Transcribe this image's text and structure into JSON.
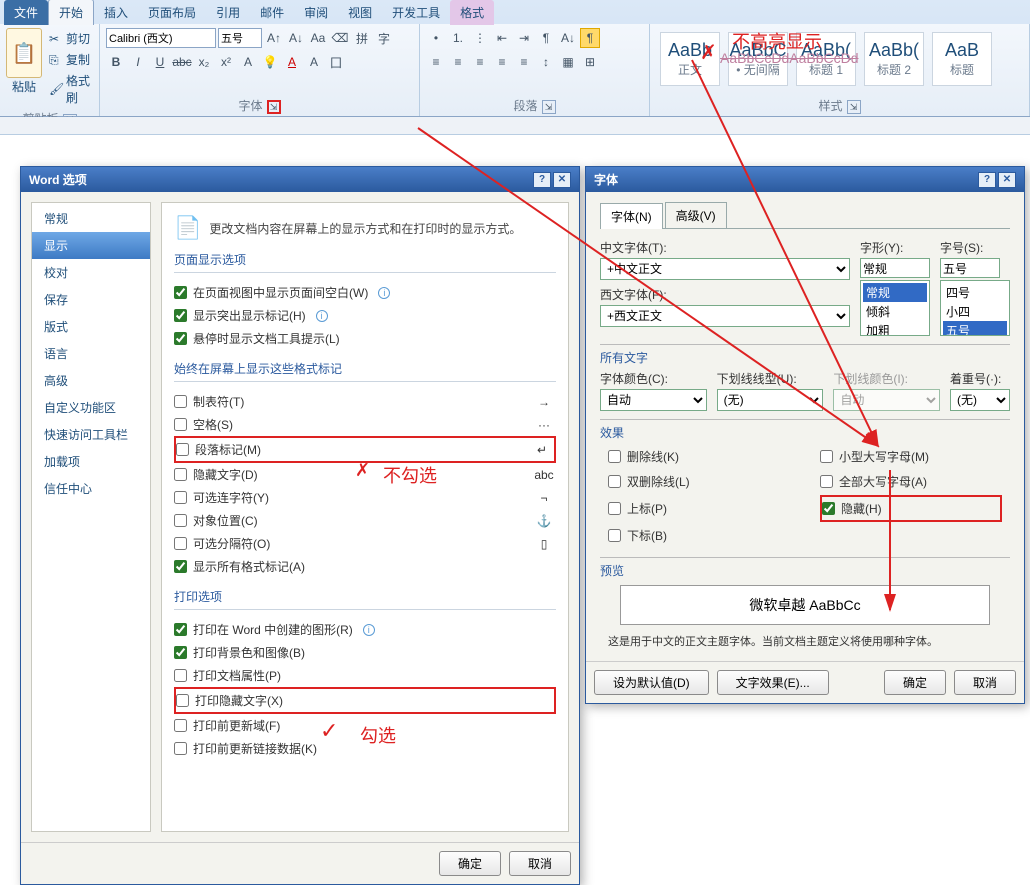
{
  "tabs": {
    "file": "文件",
    "home": "开始",
    "insert": "插入",
    "layout": "页面布局",
    "ref": "引用",
    "mail": "邮件",
    "review": "审阅",
    "view": "视图",
    "dev": "开发工具",
    "fmt": "格式"
  },
  "clip": {
    "cut": "剪切",
    "copy": "复制",
    "brush": "格式刷",
    "paste": "粘贴",
    "title": "剪贴板"
  },
  "font": {
    "name": "Calibri (西文)",
    "size": "五号",
    "title": "字体"
  },
  "para": {
    "title": "段落"
  },
  "styles": {
    "title": "样式",
    "items": [
      {
        "prev": "AaBb",
        "name": "正文"
      },
      {
        "prev": "AaBbC",
        "name": "• 无间隔"
      },
      {
        "prev": "AaBb(",
        "name": "标题 1"
      },
      {
        "prev": "AaBb(",
        "name": "标题 2"
      },
      {
        "prev": "AaB",
        "name": "标题"
      }
    ],
    "strike": "AaBbCcDdAaBbCcDd"
  },
  "anno": {
    "nohl": "不高亮显示",
    "nochk": "不勾选",
    "chk": "勾选"
  },
  "wordopt": {
    "title": "Word 选项",
    "nav": [
      "常规",
      "显示",
      "校对",
      "保存",
      "版式",
      "语言",
      "高级",
      "自定义功能区",
      "快速访问工具栏",
      "加载项",
      "信任中心"
    ],
    "navsel": 1,
    "intro": "更改文档内容在屏幕上的显示方式和在打印时的显示方式。",
    "sec1": "页面显示选项",
    "c1": [
      {
        "t": "在页面视图中显示页面间空白(W)",
        "v": true,
        "i": true
      },
      {
        "t": "显示突出显示标记(H)",
        "v": true,
        "i": true
      },
      {
        "t": "悬停时显示文档工具提示(L)",
        "v": true
      }
    ],
    "sec2": "始终在屏幕上显示这些格式标记",
    "c2": [
      {
        "t": "制表符(T)",
        "v": false,
        "s": "→"
      },
      {
        "t": "空格(S)",
        "v": false,
        "s": "···"
      },
      {
        "t": "段落标记(M)",
        "v": false,
        "s": "↵",
        "hl": true
      },
      {
        "t": "隐藏文字(D)",
        "v": false,
        "s": "abc"
      },
      {
        "t": "可选连字符(Y)",
        "v": false,
        "s": "¬"
      },
      {
        "t": "对象位置(C)",
        "v": false,
        "s": "⚓"
      },
      {
        "t": "可选分隔符(O)",
        "v": false,
        "s": "▯"
      },
      {
        "t": "显示所有格式标记(A)",
        "v": true
      }
    ],
    "sec3": "打印选项",
    "c3": [
      {
        "t": "打印在 Word 中创建的图形(R)",
        "v": true,
        "i": true
      },
      {
        "t": "打印背景色和图像(B)",
        "v": true
      },
      {
        "t": "打印文档属性(P)",
        "v": false
      },
      {
        "t": "打印隐藏文字(X)",
        "v": false,
        "hl": true
      },
      {
        "t": "打印前更新域(F)",
        "v": false
      },
      {
        "t": "打印前更新链接数据(K)",
        "v": false
      }
    ],
    "ok": "确定",
    "cancel": "取消"
  },
  "fontdlg": {
    "title": "字体",
    "tab1": "字体(N)",
    "tab2": "高级(V)",
    "cnfont": "中文字体(T):",
    "cnval": "+中文正文",
    "wfont": "西文字体(F):",
    "wval": "+西文正文",
    "style": "字形(Y):",
    "styleval": "常规",
    "styles": [
      "常规",
      "倾斜",
      "加粗"
    ],
    "size": "字号(S):",
    "sizeval": "五号",
    "sizes": [
      "四号",
      "小四",
      "五号"
    ],
    "all": "所有文字",
    "color": "字体颜色(C):",
    "colorval": "自动",
    "ul": "下划线线型(U):",
    "ulval": "(无)",
    "ulc": "下划线颜色(I):",
    "ulcval": "自动",
    "em": "着重号(·):",
    "emval": "(无)",
    "fx": "效果",
    "fxl": [
      {
        "t": "删除线(K)",
        "v": false
      },
      {
        "t": "双删除线(L)",
        "v": false
      },
      {
        "t": "上标(P)",
        "v": false
      },
      {
        "t": "下标(B)",
        "v": false
      }
    ],
    "fxr": [
      {
        "t": "小型大写字母(M)",
        "v": false
      },
      {
        "t": "全部大写字母(A)",
        "v": false
      },
      {
        "t": "隐藏(H)",
        "v": true,
        "hl": true
      }
    ],
    "pv": "预览",
    "pvtext": "微软卓越 AaBbCc",
    "note": "这是用于中文的正文主题字体。当前文档主题定义将使用哪种字体。",
    "def": "设为默认值(D)",
    "txfx": "文字效果(E)...",
    "ok": "确定",
    "cancel": "取消"
  }
}
